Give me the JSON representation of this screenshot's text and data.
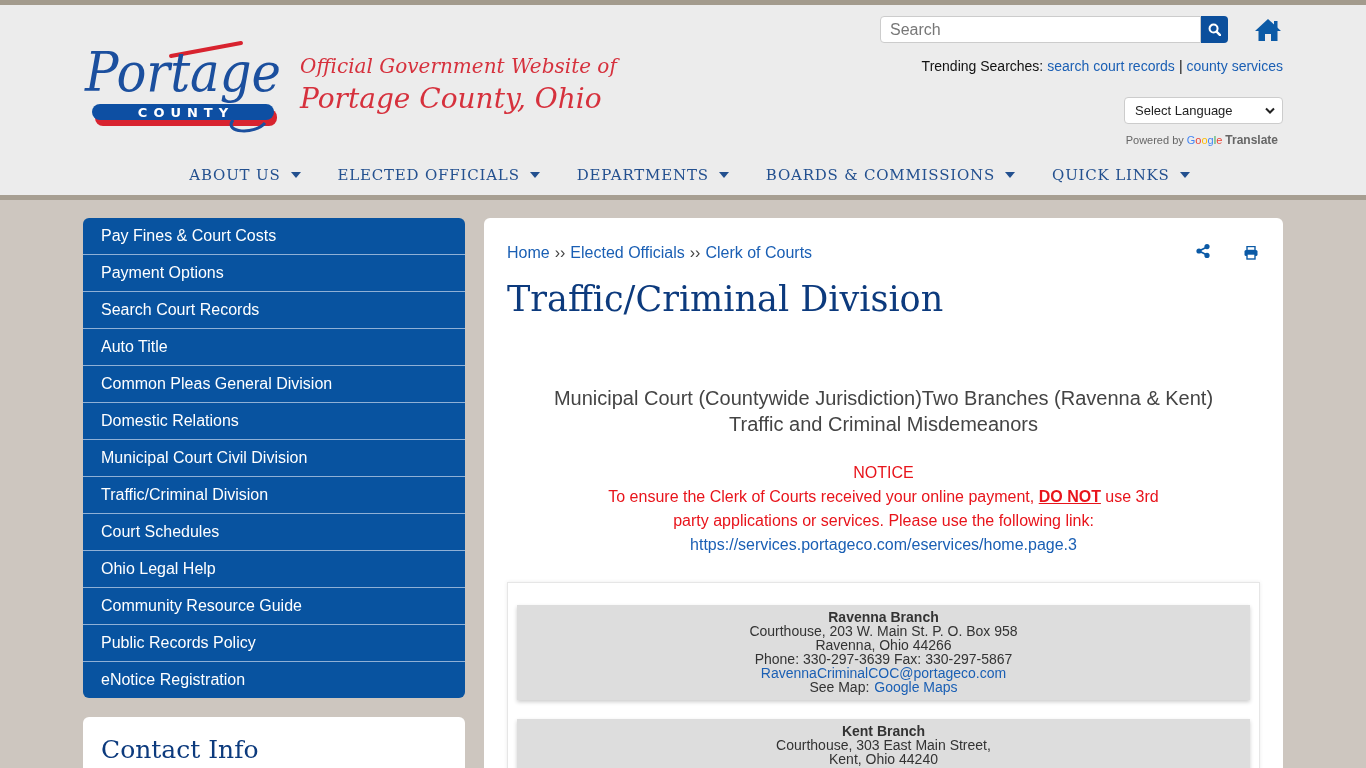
{
  "header": {
    "logo": {
      "script": "Portage",
      "banner": "COUNTY"
    },
    "tagline": "Official Government Website of",
    "site_name": "Portage County, Ohio",
    "search": {
      "placeholder": "Search"
    },
    "trending": {
      "label": "Trending Searches:",
      "links": [
        {
          "text": "search court records"
        },
        {
          "separator": "|",
          "text": "county services"
        }
      ]
    },
    "language_select": {
      "value": "Select Language"
    },
    "translate_credit": {
      "prefix": "Powered by",
      "brand": "Google",
      "product": "Translate"
    }
  },
  "nav": [
    {
      "label": "ABOUT US",
      "has_menu": true
    },
    {
      "label": "ELECTED OFFICIALS",
      "has_menu": true
    },
    {
      "label": "DEPARTMENTS",
      "has_menu": true
    },
    {
      "label": "BOARDS & COMMISSIONS",
      "has_menu": true
    },
    {
      "label": "QUICK LINKS",
      "has_menu": true
    }
  ],
  "sidebar": {
    "items": [
      "Pay Fines & Court Costs",
      "Payment Options",
      "Search Court Records",
      "Auto Title",
      "Common Pleas General Division",
      "Domestic Relations",
      "Municipal Court Civil Division",
      "Traffic/Criminal Division",
      "Court Schedules",
      "Ohio Legal Help",
      "Community Resource Guide",
      "Public Records Policy",
      "eNotice Registration"
    ]
  },
  "contact_card": {
    "title": "Contact Info"
  },
  "content": {
    "breadcrumb": [
      {
        "label": "Home"
      },
      {
        "separator": "››",
        "label": "Elected Officials"
      },
      {
        "separator": "››",
        "label": "Clerk of Courts"
      }
    ],
    "title": "Traffic/Criminal Division",
    "subtitle_lines": [
      "Municipal Court (Countywide Jurisdiction)Two Branches (Ravenna & Kent)",
      "Traffic and Criminal Misdemeanors"
    ],
    "notice": {
      "heading": "NOTICE",
      "text": "To ensure the Clerk of Courts received your online payment, **DO NOT** use 3rd party applications or services. Please use the following link:",
      "link": "https://services.portageco.com/eservices/home.page.3"
    },
    "branches": [
      {
        "name": "Ravenna Branch",
        "lines": [
          "Courthouse, 203 W. Main St. P. O. Box 958",
          "Ravenna, Ohio 44266",
          "Phone: 330-297-3639 Fax: 330-297-5867"
        ],
        "email": "RavennaCriminalCOC@portageco.com",
        "map_label": "See Map:",
        "map_link": "Google Maps"
      },
      {
        "name": "Kent Branch",
        "lines": [
          "Courthouse, 303 East Main Street,",
          "Kent, Ohio 44240"
        ]
      }
    ]
  }
}
